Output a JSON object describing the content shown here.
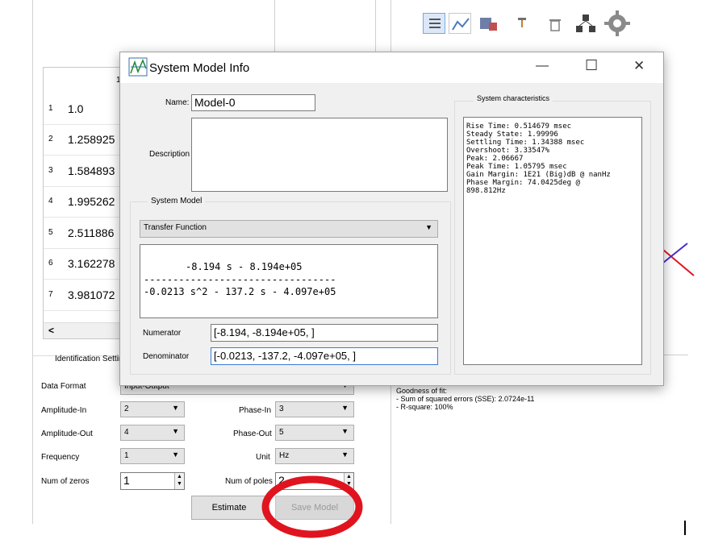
{
  "toolbar": {
    "icons": [
      "list-icon",
      "chart-line-icon",
      "model-icon",
      "pin-icon",
      "trash-icon",
      "network-icon",
      "gear-icon"
    ]
  },
  "table": {
    "header_col": "1",
    "rows": [
      {
        "num": "1",
        "value": "1.0"
      },
      {
        "num": "2",
        "value": "1.258925"
      },
      {
        "num": "3",
        "value": "1.584893"
      },
      {
        "num": "4",
        "value": "1.995262"
      },
      {
        "num": "5",
        "value": "2.511886"
      },
      {
        "num": "6",
        "value": "3.162278"
      },
      {
        "num": "7",
        "value": "3.981072"
      }
    ],
    "scroll_left": "<"
  },
  "identification": {
    "title": "Identification Settin",
    "data_format_label": "Data Format",
    "data_format_value": "Input-Output",
    "amplitude_in_label": "Amplitude-In",
    "amplitude_in_value": "2",
    "phase_in_label": "Phase-In",
    "phase_in_value": "3",
    "amplitude_out_label": "Amplitude-Out",
    "amplitude_out_value": "4",
    "phase_out_label": "Phase-Out",
    "phase_out_value": "5",
    "frequency_label": "Frequency",
    "frequency_value": "1",
    "unit_label": "Unit",
    "unit_value": "Hz",
    "num_zeros_label": "Num of zeros",
    "num_zeros_value": "1",
    "num_poles_label": "Num of poles",
    "num_poles_value": "2",
    "estimate_label": "Estimate",
    "save_model_label": "Save Model"
  },
  "fit": {
    "title": "Goodness of fit:",
    "sse": "- Sum of squared errors (SSE): 2.0724e-11",
    "rsquare": "- R-square: 100%"
  },
  "dialog": {
    "title": "System Model Info",
    "minimize": "—",
    "maximize": "☐",
    "close": "✕",
    "name_label": "Name:",
    "name_value": "Model-0",
    "description_label": "Description",
    "description_value": "",
    "system_model_title": "System Model",
    "model_type": "Transfer Function",
    "tf_numerator_text": "-8.194 s - 8.194e+05",
    "tf_divider": "---------------------------------",
    "tf_denominator_text": "-0.0213 s^2 - 137.2 s - 4.097e+05",
    "numerator_label": "Numerator",
    "numerator_value": "[-8.194, -8.194e+05, ]",
    "denominator_label": "Denominator",
    "denominator_value": "[-0.0213, -137.2, -4.097e+05, ]",
    "characteristics_title": "System characteristics",
    "characteristics": [
      "Rise Time: 0.514679 msec",
      "Steady State: 1.99996",
      "Settling Time: 1.34388 msec",
      "Overshoot: 3.33547%",
      "Peak: 2.06667",
      "Peak Time: 1.05795 msec",
      "Gain Margin: 1E21 (Big)dB @ nanHz",
      "Phase Margin: 74.0425deg @",
      "898.812Hz"
    ]
  },
  "colors": {
    "highlight_circle": "#e0141e",
    "plot_red": "#e0141e",
    "plot_blue": "#4a2ad0",
    "dialog_bg": "#f0f0f0"
  }
}
